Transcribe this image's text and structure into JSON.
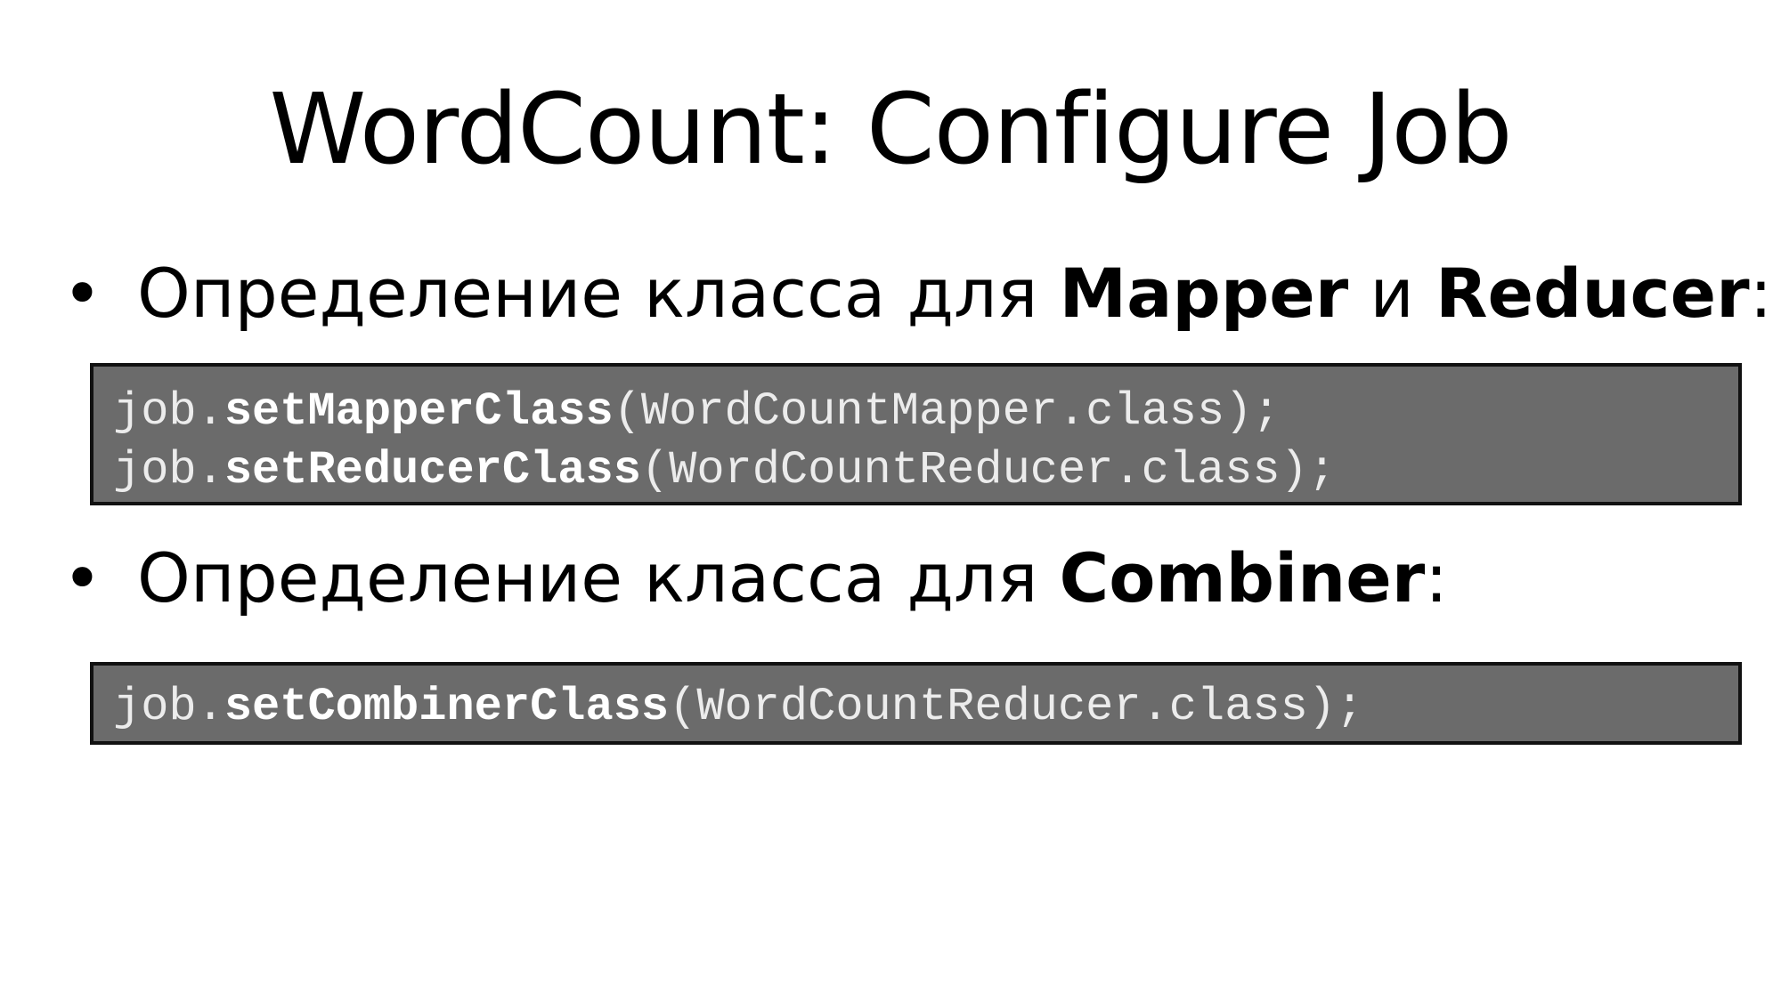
{
  "slide": {
    "title": "WordCount: Configure Job",
    "bullets": [
      {
        "marker": "•",
        "prefix": "Определение класса для ",
        "term1": "Mapper",
        "joiner": " и ",
        "term2": "Reducer",
        "suffix": ":"
      },
      {
        "marker": "•",
        "prefix": "Определение класса для ",
        "term1": "Combiner",
        "suffix": ":"
      }
    ],
    "code_blocks": [
      {
        "lines": [
          {
            "object": "job.",
            "method": "setMapperClass",
            "args": "(WordCountMapper.class);"
          },
          {
            "object": "job.",
            "method": "setReducerClass",
            "args": "(WordCountReducer.class);"
          }
        ]
      },
      {
        "lines": [
          {
            "object": "job.",
            "method": "setCombinerClass",
            "args": "(WordCountReducer.class);"
          }
        ]
      }
    ]
  },
  "colors": {
    "background": "#ffffff",
    "code_background": "#6b6b6b",
    "code_border": "#111111",
    "code_text": "#ececec"
  }
}
